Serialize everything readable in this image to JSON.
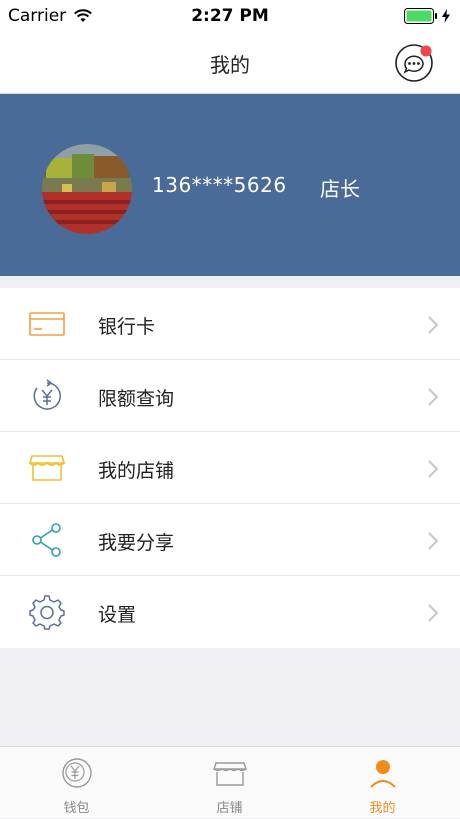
{
  "status_bar": {
    "carrier": "Carrier",
    "time": "2:27 PM"
  },
  "nav": {
    "title": "我的",
    "message_icon": "chat-bubble-icon",
    "badge_color": "#f0454a"
  },
  "profile": {
    "phone": "136****5626",
    "role": "店长",
    "background": "#4a6a98"
  },
  "menu": {
    "items": [
      {
        "label": "银行卡",
        "icon": "bank-card-icon"
      },
      {
        "label": "限额查询",
        "icon": "limit-query-icon"
      },
      {
        "label": "我的店铺",
        "icon": "shop-icon"
      },
      {
        "label": "我要分享",
        "icon": "share-icon"
      },
      {
        "label": "设置",
        "icon": "settings-gear-icon"
      }
    ]
  },
  "tabbar": {
    "tabs": [
      {
        "label": "钱包",
        "icon": "wallet-icon",
        "active": false
      },
      {
        "label": "店铺",
        "icon": "store-icon",
        "active": false
      },
      {
        "label": "我的",
        "icon": "user-icon",
        "active": true
      }
    ],
    "active_color": "#f08c1e"
  }
}
